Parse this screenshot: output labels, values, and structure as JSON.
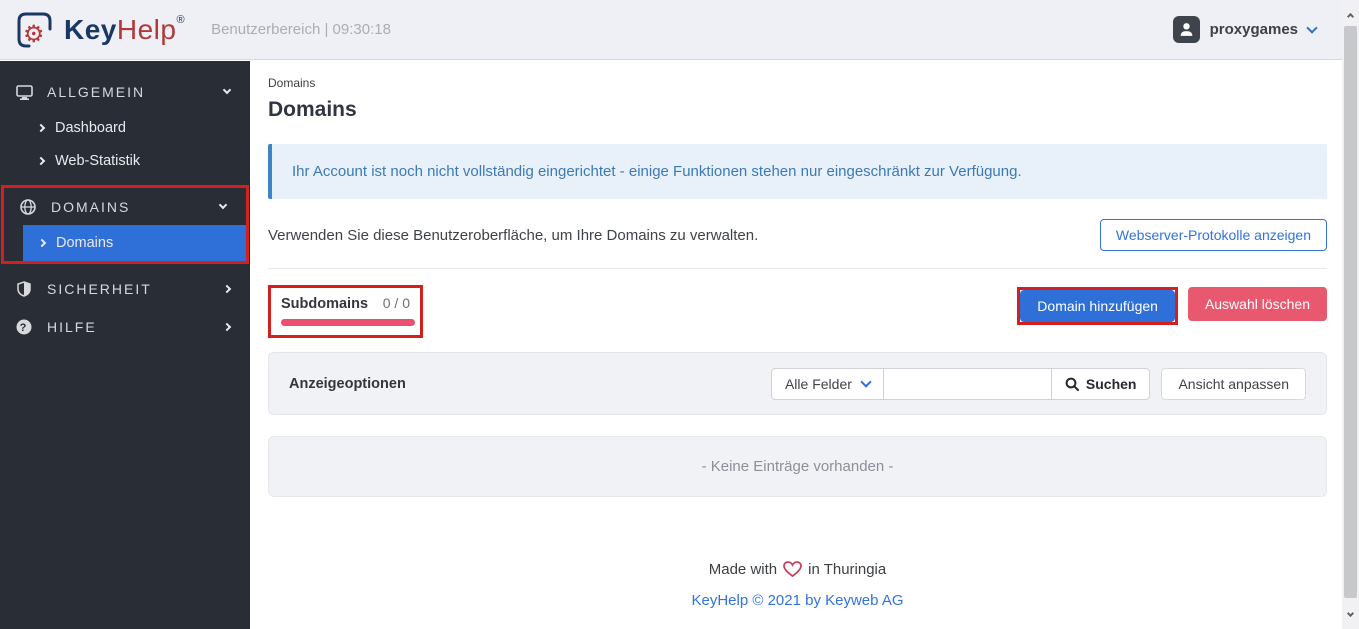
{
  "topbar": {
    "logo": {
      "key": "Key",
      "help": "Help",
      "registered": "®",
      "gear_glyph": "⚙"
    },
    "subtitle": "Benutzerbereich | 09:30:18",
    "user": {
      "name": "proxygames"
    }
  },
  "sidebar": {
    "sections": [
      {
        "label": "ALLGEMEIN",
        "icon": "monitor-icon",
        "expanded": true,
        "items": [
          {
            "label": "Dashboard"
          },
          {
            "label": "Web-Statistik"
          }
        ]
      },
      {
        "label": "DOMAINS",
        "icon": "globe-icon",
        "expanded": true,
        "annotated": true,
        "items": [
          {
            "label": "Domains",
            "active": true
          }
        ]
      },
      {
        "label": "SICHERHEIT",
        "icon": "shield-icon",
        "expanded": false,
        "items": []
      },
      {
        "label": "HILFE",
        "icon": "question-icon",
        "expanded": false,
        "items": []
      }
    ]
  },
  "main": {
    "breadcrumb": "Domains",
    "title": "Domains",
    "alert": "Ihr Account ist noch nicht vollständig eingerichtet - einige Funktionen stehen nur eingeschränkt zur Verfügung.",
    "intro": "Verwenden Sie diese Benutzeroberfläche, um Ihre Domains zu verwalten.",
    "webserver_logs_button": "Webserver-Protokolle anzeigen",
    "quota": {
      "label": "Subdomains",
      "value": "0 / 0"
    },
    "add_domain_button": "Domain hinzufügen",
    "delete_selection_button": "Auswahl löschen",
    "display_options": {
      "label": "Anzeigeoptionen",
      "field_select_value": "Alle Felder",
      "search_input_value": "",
      "search_button": "Suchen",
      "customize_view_button": "Ansicht anpassen"
    },
    "empty_state": "- Keine Einträge vorhanden -"
  },
  "footer": {
    "made_prefix": "Made with",
    "made_suffix": "in Thuringia",
    "copyright": "KeyHelp © 2021 by Keyweb AG"
  },
  "colors": {
    "accent_blue": "#2e6fd8",
    "danger_pink": "#e8596f",
    "progress_pink": "#e94f6e",
    "annotation_red": "#d21f1f",
    "link_blue": "#3273dc",
    "logo_navy": "#1b3764",
    "logo_red": "#b5373a",
    "alert_text": "#3d7ab5",
    "sidebar_bg": "#282d36"
  }
}
